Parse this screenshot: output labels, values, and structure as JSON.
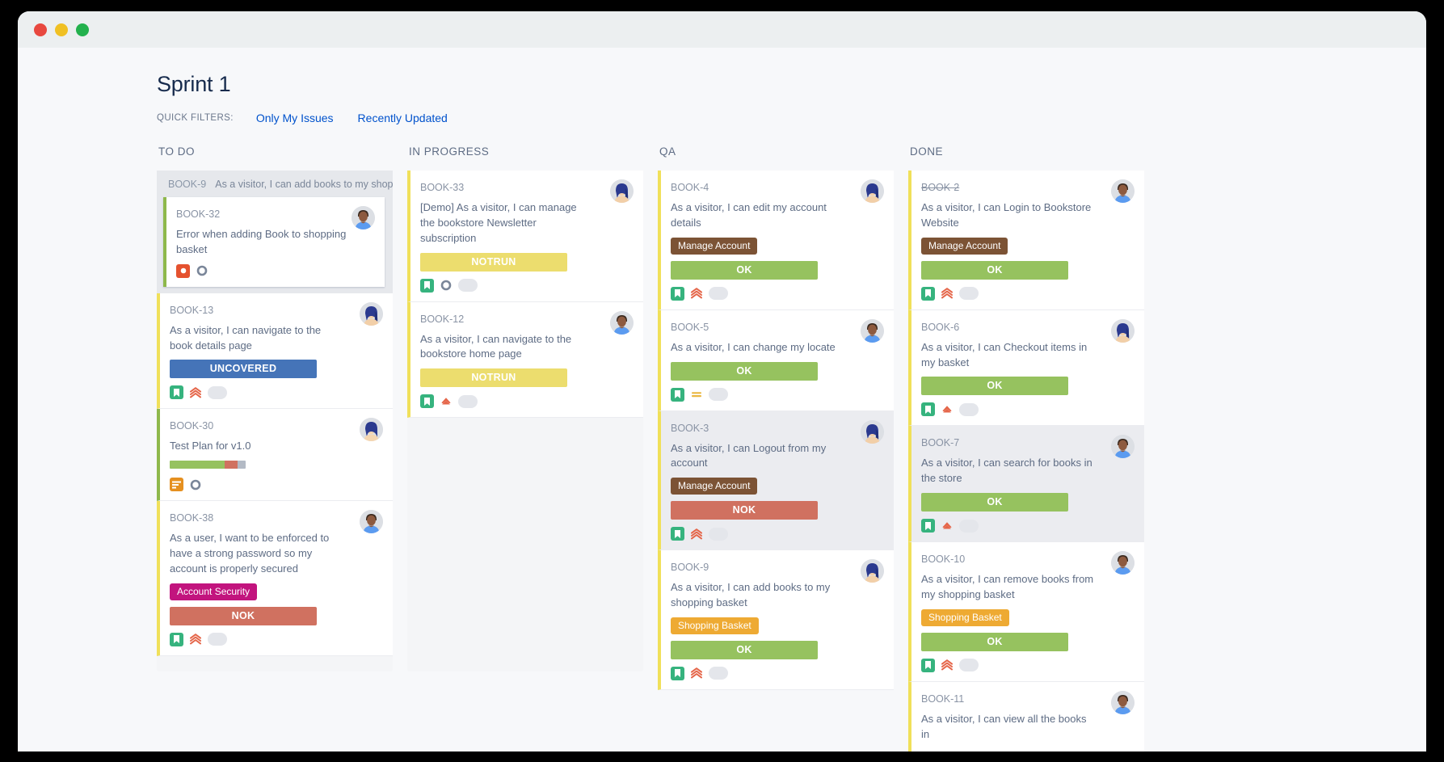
{
  "window": {
    "controls": [
      "close",
      "minimize",
      "maximize"
    ]
  },
  "header": {
    "title": "Sprint 1",
    "quick_filters_label": "QUICK FILTERS:",
    "quick_filters": [
      {
        "label": "Only My Issues"
      },
      {
        "label": "Recently Updated"
      }
    ],
    "link_color": "#0052cc"
  },
  "status_colors": {
    "ok": "#96c25f",
    "nok": "#d07160",
    "notrun": "#ecdd6e",
    "uncovered": "#4574b8"
  },
  "label_colors": {
    "manage_account": "#7c5335",
    "account_security": "#c2147e",
    "shopping_basket": "#eeaa33"
  },
  "columns": [
    {
      "name": "TO DO",
      "ghost": {
        "key": "BOOK-9",
        "summary": "As a visitor, I can add books to my shopping"
      },
      "cards": [
        {
          "key": "BOOK-32",
          "summary": "Error when adding Book to shopping basket",
          "bar": "green",
          "in_ghost": true,
          "labels": [],
          "status": null,
          "progress": null,
          "type_icon": "bug-icon",
          "priority_icon": null,
          "estimate": "circle-outline-icon",
          "avatar": "avatar-male-dark",
          "selected": false,
          "resolved": false
        },
        {
          "key": "BOOK-13",
          "summary": "As a visitor, I can navigate to the book details page",
          "bar": "yellow",
          "in_ghost": false,
          "labels": [],
          "status": {
            "text": "UNCOVERED",
            "variant": "uncovered"
          },
          "progress": null,
          "type_icon": "story-icon",
          "priority_icon": "priority-highest-icon",
          "estimate": "estimate-pill",
          "avatar": "avatar-female-blue",
          "selected": false,
          "resolved": false
        },
        {
          "key": "BOOK-30",
          "summary": "Test Plan for v1.0",
          "bar": "green",
          "in_ghost": false,
          "labels": [],
          "status": null,
          "progress": [
            72,
            17,
            11
          ],
          "type_icon": "task-icon",
          "priority_icon": null,
          "estimate": "circle-outline-icon",
          "avatar": "avatar-female-light",
          "selected": false,
          "resolved": false
        },
        {
          "key": "BOOK-38",
          "summary": "As a user, I want to be enforced to have a strong password so my account is properly secured",
          "bar": "yellow",
          "in_ghost": false,
          "labels": [
            {
              "text": "Account Security",
              "variant": "pink"
            }
          ],
          "status": {
            "text": "NOK",
            "variant": "nok"
          },
          "progress": null,
          "type_icon": "story-icon",
          "priority_icon": "priority-highest-icon",
          "estimate": "estimate-pill",
          "avatar": "avatar-male-dark",
          "selected": false,
          "resolved": false
        }
      ]
    },
    {
      "name": "IN PROGRESS",
      "ghost": null,
      "cards": [
        {
          "key": "BOOK-33",
          "summary": "[Demo] As a visitor, I can manage the bookstore Newsletter subscription",
          "bar": "yellow",
          "in_ghost": false,
          "labels": [],
          "status": {
            "text": "NOTRUN",
            "variant": "notrun"
          },
          "progress": null,
          "type_icon": "story-icon",
          "priority_icon": "circle-outline-icon",
          "estimate": "estimate-pill",
          "avatar": "avatar-female-blue",
          "selected": false,
          "resolved": false
        },
        {
          "key": "BOOK-12",
          "summary": "As a visitor, I can navigate to the bookstore home page",
          "bar": "yellow",
          "in_ghost": false,
          "labels": [],
          "status": {
            "text": "NOTRUN",
            "variant": "notrun"
          },
          "progress": null,
          "type_icon": "story-icon",
          "priority_icon": "priority-high-icon",
          "estimate": "estimate-pill",
          "avatar": "avatar-male-dark",
          "selected": false,
          "resolved": false
        }
      ]
    },
    {
      "name": "QA",
      "ghost": null,
      "cards": [
        {
          "key": "BOOK-4",
          "summary": "As a visitor, I can edit my account details",
          "bar": "yellow",
          "in_ghost": false,
          "labels": [
            {
              "text": "Manage Account",
              "variant": "brown"
            }
          ],
          "status": {
            "text": "OK",
            "variant": "ok"
          },
          "progress": null,
          "type_icon": "story-icon",
          "priority_icon": "priority-highest-icon",
          "estimate": "estimate-pill",
          "avatar": "avatar-female-blue",
          "selected": false,
          "resolved": false
        },
        {
          "key": "BOOK-5",
          "summary": "As a visitor, I can change my locate",
          "bar": "yellow",
          "in_ghost": false,
          "labels": [],
          "status": {
            "text": "OK",
            "variant": "ok"
          },
          "progress": null,
          "type_icon": "story-icon",
          "priority_icon": "priority-medium-icon",
          "estimate": "estimate-pill",
          "avatar": "avatar-male-dark",
          "selected": false,
          "resolved": false
        },
        {
          "key": "BOOK-3",
          "summary": "As a visitor, I can Logout from my account",
          "bar": "yellow",
          "in_ghost": false,
          "labels": [
            {
              "text": "Manage Account",
              "variant": "brown"
            }
          ],
          "status": {
            "text": "NOK",
            "variant": "nok"
          },
          "progress": null,
          "type_icon": "story-icon",
          "priority_icon": "priority-highest-icon",
          "estimate": "estimate-pill",
          "avatar": "avatar-female-blue",
          "selected": true,
          "resolved": false
        },
        {
          "key": "BOOK-9",
          "summary": "As a visitor, I can add books to my shopping basket",
          "bar": "yellow",
          "in_ghost": false,
          "labels": [
            {
              "text": "Shopping Basket",
              "variant": "orange"
            }
          ],
          "status": {
            "text": "OK",
            "variant": "ok"
          },
          "progress": null,
          "type_icon": "story-icon",
          "priority_icon": "priority-highest-icon",
          "estimate": "estimate-pill",
          "avatar": "avatar-female-blue",
          "selected": false,
          "resolved": false
        }
      ]
    },
    {
      "name": "DONE",
      "ghost": null,
      "cards": [
        {
          "key": "BOOK-2",
          "summary": "As a visitor, I can Login to Bookstore Website",
          "bar": "yellow",
          "in_ghost": false,
          "labels": [
            {
              "text": "Manage Account",
              "variant": "brown"
            }
          ],
          "status": {
            "text": "OK",
            "variant": "ok"
          },
          "progress": null,
          "type_icon": "story-icon",
          "priority_icon": "priority-highest-icon",
          "estimate": "estimate-pill",
          "avatar": "avatar-male-dark",
          "selected": false,
          "resolved": true
        },
        {
          "key": "BOOK-6",
          "summary": "As a visitor, I can Checkout items in my basket",
          "bar": "yellow",
          "in_ghost": false,
          "labels": [],
          "status": {
            "text": "OK",
            "variant": "ok"
          },
          "progress": null,
          "type_icon": "story-icon",
          "priority_icon": "priority-high-icon",
          "estimate": "estimate-pill",
          "avatar": "avatar-female-blue",
          "selected": false,
          "resolved": false
        },
        {
          "key": "BOOK-7",
          "summary": "As a visitor, I can search for books in the store",
          "bar": "yellow",
          "in_ghost": false,
          "labels": [],
          "status": {
            "text": "OK",
            "variant": "ok"
          },
          "progress": null,
          "type_icon": "story-icon",
          "priority_icon": "priority-high-icon",
          "estimate": "estimate-pill",
          "avatar": "avatar-male-dark",
          "selected": true,
          "resolved": false
        },
        {
          "key": "BOOK-10",
          "summary": "As a visitor, I can remove books from my shopping basket",
          "bar": "yellow",
          "in_ghost": false,
          "labels": [
            {
              "text": "Shopping Basket",
              "variant": "orange"
            }
          ],
          "status": {
            "text": "OK",
            "variant": "ok"
          },
          "progress": null,
          "type_icon": "story-icon",
          "priority_icon": "priority-highest-icon",
          "estimate": "estimate-pill",
          "avatar": "avatar-male-dark",
          "selected": false,
          "resolved": false
        },
        {
          "key": "BOOK-11",
          "summary": "As a visitor, I can view all the books in",
          "bar": "yellow",
          "in_ghost": false,
          "labels": [],
          "status": null,
          "progress": null,
          "type_icon": null,
          "priority_icon": null,
          "estimate": null,
          "avatar": "avatar-male-dark",
          "selected": false,
          "resolved": false
        }
      ]
    }
  ]
}
